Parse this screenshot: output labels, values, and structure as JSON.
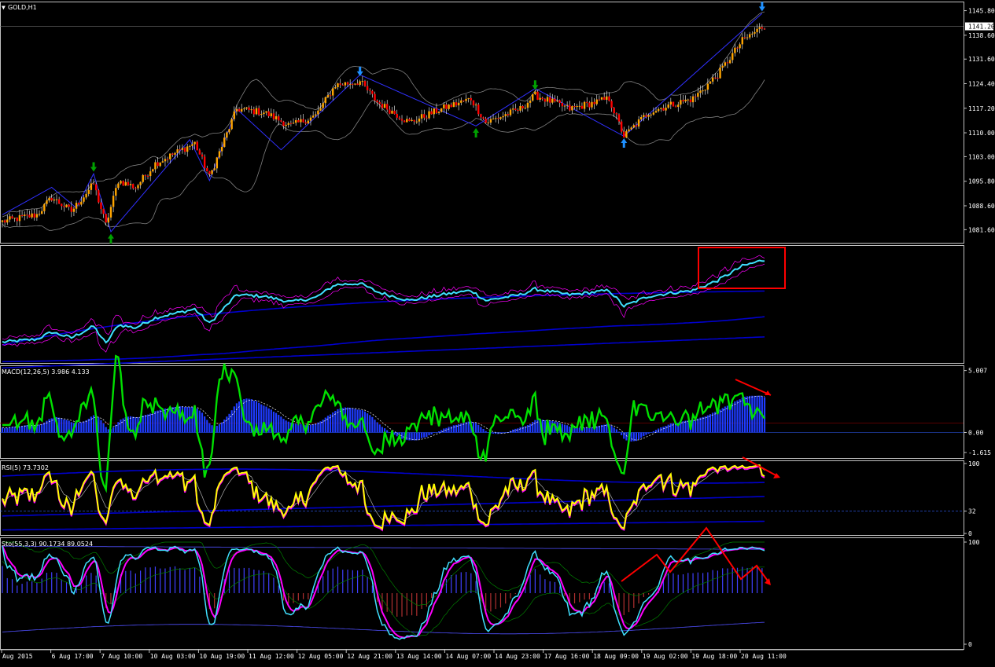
{
  "window": {
    "title": "GOLD,H1"
  },
  "colors": {
    "bg": "#000000",
    "frame": "#c0c0c0",
    "up": "#ffa500",
    "down": "#ff0000",
    "band": "#808080",
    "zigzag": "#3030ff",
    "arrow_up": "#1e90ff",
    "arrow_dn": "#1e90ff",
    "green_arrow": "#00a000",
    "cyan": "#40e0ff",
    "green": "#00e000",
    "yellow": "#ffff00",
    "magenta": "#ff00ff",
    "blue": "#0000cd",
    "red": "#ff0000"
  },
  "chart_data": [
    {
      "type": "candlestick",
      "title": "GOLD,H1",
      "ylim": [
        1078,
        1148
      ],
      "y_ticks": [
        "1145.80",
        "1138.60",
        "1131.60",
        "1124.40",
        "1117.20",
        "1110.00",
        "1103.00",
        "1095.80",
        "1088.60",
        "1081.60"
      ],
      "y_tick_values": [
        1145.8,
        1138.6,
        1131.6,
        1124.4,
        1117.2,
        1110.0,
        1103.0,
        1095.8,
        1088.6,
        1081.6
      ],
      "current_price_label": "1141.20",
      "current_price": 1141.2,
      "path_keypoints": [
        {
          "i": 0,
          "v": 1084
        },
        {
          "i": 14,
          "v": 1086
        },
        {
          "i": 20,
          "v": 1091
        },
        {
          "i": 28,
          "v": 1087
        },
        {
          "i": 37,
          "v": 1095
        },
        {
          "i": 42,
          "v": 1083
        },
        {
          "i": 47,
          "v": 1096
        },
        {
          "i": 54,
          "v": 1094
        },
        {
          "i": 62,
          "v": 1101
        },
        {
          "i": 78,
          "v": 1107
        },
        {
          "i": 84,
          "v": 1097
        },
        {
          "i": 95,
          "v": 1117
        },
        {
          "i": 106,
          "v": 1116
        },
        {
          "i": 117,
          "v": 1112
        },
        {
          "i": 127,
          "v": 1115
        },
        {
          "i": 135,
          "v": 1124
        },
        {
          "i": 145,
          "v": 1125
        },
        {
          "i": 152,
          "v": 1119
        },
        {
          "i": 165,
          "v": 1113
        },
        {
          "i": 178,
          "v": 1117
        },
        {
          "i": 190,
          "v": 1120
        },
        {
          "i": 196,
          "v": 1113
        },
        {
          "i": 210,
          "v": 1117
        },
        {
          "i": 216,
          "v": 1121
        },
        {
          "i": 230,
          "v": 1117
        },
        {
          "i": 246,
          "v": 1120
        },
        {
          "i": 252,
          "v": 1109
        },
        {
          "i": 262,
          "v": 1116
        },
        {
          "i": 270,
          "v": 1118
        },
        {
          "i": 280,
          "v": 1120
        },
        {
          "i": 290,
          "v": 1127
        },
        {
          "i": 300,
          "v": 1137
        },
        {
          "i": 308,
          "v": 1141
        }
      ],
      "zigzag_points": [
        {
          "i": 0,
          "v": 1086
        },
        {
          "i": 20,
          "v": 1094
        },
        {
          "i": 30,
          "v": 1088
        },
        {
          "i": 37,
          "v": 1098
        },
        {
          "i": 44,
          "v": 1081
        },
        {
          "i": 76,
          "v": 1108
        },
        {
          "i": 84,
          "v": 1096
        },
        {
          "i": 95,
          "v": 1117
        },
        {
          "i": 113,
          "v": 1105
        },
        {
          "i": 145,
          "v": 1127
        },
        {
          "i": 192,
          "v": 1112
        },
        {
          "i": 216,
          "v": 1123
        },
        {
          "i": 252,
          "v": 1109
        },
        {
          "i": 308,
          "v": 1145
        }
      ],
      "arrows": [
        {
          "i": 37,
          "v": 1100,
          "dir": "down",
          "color": "green"
        },
        {
          "i": 44,
          "v": 1079,
          "dir": "up",
          "color": "green"
        },
        {
          "i": 145,
          "v": 1128,
          "dir": "down",
          "color": "blue"
        },
        {
          "i": 192,
          "v": 1110,
          "dir": "up",
          "color": "green"
        },
        {
          "i": 216,
          "v": 1124,
          "dir": "down",
          "color": "green"
        },
        {
          "i": 252,
          "v": 1107,
          "dir": "up",
          "color": "blue"
        },
        {
          "i": 308,
          "v": 1147,
          "dir": "down",
          "color": "blue"
        }
      ]
    },
    {
      "type": "line",
      "title": "",
      "series": [
        {
          "values_from": "price"
        }
      ],
      "overlay_box": true
    },
    {
      "type": "bar",
      "title": "MACD(12,26,5) 3.986 4.133",
      "ylim": [
        -2.0,
        5.3
      ],
      "y_ticks": [
        "5.007",
        "0.00",
        "-1.615"
      ],
      "y_tick_values": [
        5.007,
        0.0,
        -1.615
      ]
    },
    {
      "type": "line",
      "title": "RSI(5) 73.7302",
      "ylim": [
        0,
        100
      ],
      "y_ticks": [
        "100",
        "32",
        "0"
      ],
      "y_tick_values": [
        100,
        32,
        0
      ]
    },
    {
      "type": "line",
      "title": "Sto(55,3,3) 90.1734 89.0524",
      "ylim": [
        0,
        100
      ],
      "y_ticks": [
        "100",
        "0"
      ],
      "y_tick_values": [
        100,
        0
      ]
    }
  ],
  "x_axis": {
    "labels": [
      "Aug 2015",
      "6 Aug 17:00",
      "7 Aug 10:00",
      "10 Aug 03:00",
      "10 Aug 19:00",
      "11 Aug 12:00",
      "12 Aug 05:00",
      "12 Aug 21:00",
      "13 Aug 14:00",
      "14 Aug 07:00",
      "14 Aug 23:00",
      "17 Aug 16:00",
      "18 Aug 09:00",
      "19 Aug 02:00",
      "19 Aug 18:00",
      "20 Aug 11:00"
    ]
  }
}
